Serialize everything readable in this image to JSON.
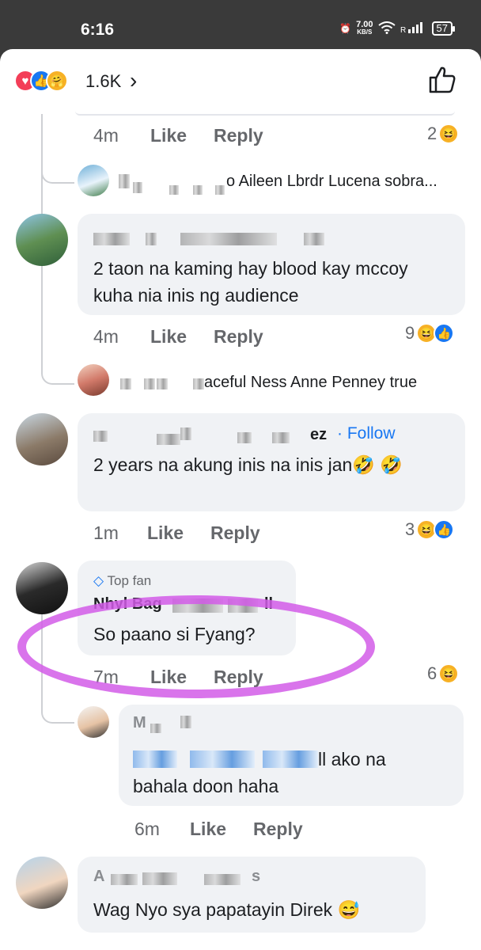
{
  "status_bar": {
    "time": "6:16",
    "speed_value": "7.00",
    "speed_unit": "KB/S",
    "battery": "57"
  },
  "header": {
    "reaction_count": "1.6K",
    "chevron": "›"
  },
  "comments": [
    {
      "meta": {
        "time": "4m",
        "like": "Like",
        "reply": "Reply",
        "reaction_count": "2"
      }
    },
    {
      "reply_preview": "o Aileen Lbrdr Lucena sobra..."
    },
    {
      "text": "2 taon na kaming hay blood kay mccoy kuha nia inis ng audience",
      "meta": {
        "time": "4m",
        "like": "Like",
        "reply": "Reply",
        "reaction_count": "9"
      }
    },
    {
      "reply_preview": "aceful Ness Anne Penney true"
    },
    {
      "name_suffix": "ez",
      "follow": "· Follow",
      "text": "2 years na akung inis na inis jan🤣 🤣",
      "meta": {
        "time": "1m",
        "like": "Like",
        "reply": "Reply",
        "reaction_count": "3"
      }
    },
    {
      "badge": "Top fan",
      "name_visible": "Nhyl Bag",
      "name_end": "ll",
      "text": "So paano si Fyang?",
      "meta": {
        "time": "7m",
        "like": "Like",
        "reply": "Reply",
        "reaction_count": "6"
      }
    },
    {
      "name_initial": "M",
      "text_visible_end": "ll ako na",
      "text_line2": "bahala doon haha",
      "meta": {
        "time": "6m",
        "like": "Like",
        "reply": "Reply"
      }
    },
    {
      "name_initial": "A",
      "name_end": "s",
      "text": "Wag Nyo sya papatayin Direk 😅"
    }
  ],
  "colors": {
    "accent": "#1877f2",
    "annotation": "#d25ce8",
    "bubble": "#f0f2f5"
  }
}
